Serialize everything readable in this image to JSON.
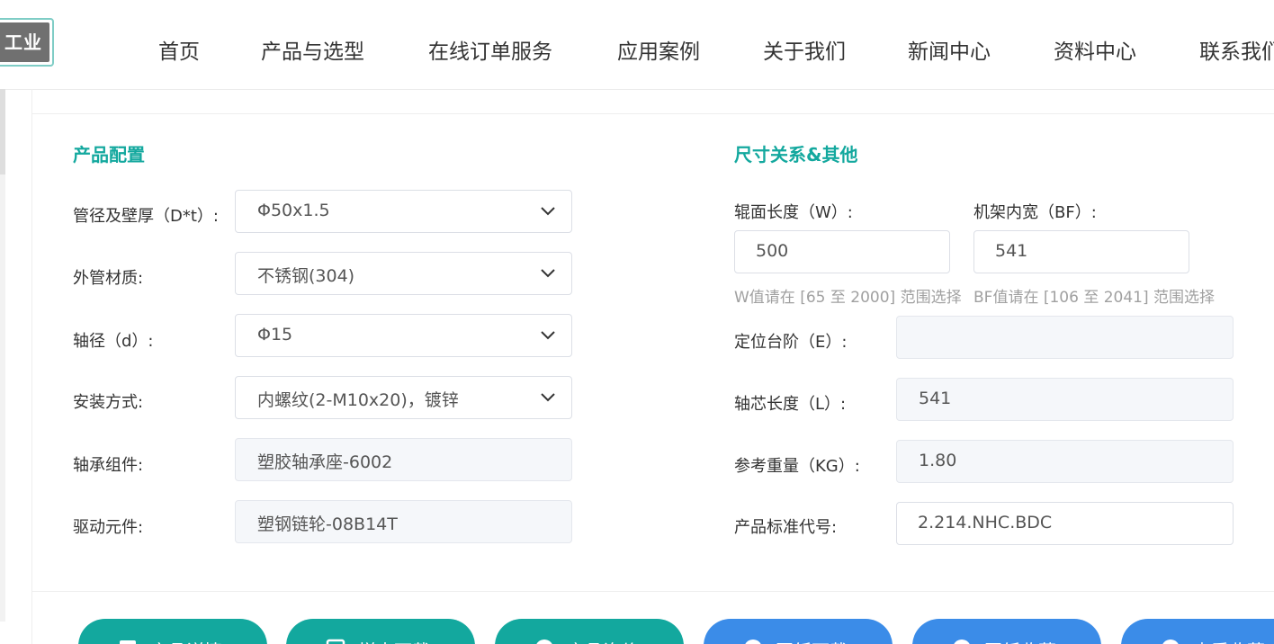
{
  "header": {
    "logo_text": "工业",
    "nav": [
      "首页",
      "产品与选型",
      "在线订单服务",
      "应用案例",
      "关于我们",
      "新闻中心",
      "资料中心",
      "联系我们"
    ]
  },
  "left_section": {
    "title": "产品配置",
    "fields": [
      {
        "label": "管径及壁厚（D*t）:",
        "value": "Φ50x1.5",
        "type": "select"
      },
      {
        "label": "外管材质:",
        "value": "不锈钢(304)",
        "type": "select"
      },
      {
        "label": "轴径（d）:",
        "value": "Φ15",
        "type": "select"
      },
      {
        "label": "安装方式:",
        "value": "内螺纹(2-M10x20)，镀锌",
        "type": "select"
      },
      {
        "label": "轴承组件:",
        "value": "塑胶轴承座-6002",
        "type": "readonly"
      },
      {
        "label": "驱动元件:",
        "value": "塑钢链轮-08B14T",
        "type": "readonly"
      }
    ]
  },
  "right_section": {
    "title": "尺寸关系&其他",
    "w_label": "辊面长度（W）:",
    "w_value": "500",
    "w_hint": "W值请在 [65 至 2000] 范围选择",
    "bf_label": "机架内宽（BF）:",
    "bf_value": "541",
    "bf_hint": "BF值请在 [106 至 2041] 范围选择",
    "fields": [
      {
        "label": "定位台阶（E）:",
        "value": "",
        "type": "readonly"
      },
      {
        "label": "轴芯长度（L）:",
        "value": "541",
        "type": "readonly"
      },
      {
        "label": "参考重量（KG）:",
        "value": "1.80",
        "type": "readonly"
      },
      {
        "label": "产品标准代号:",
        "value": "2.214.NHC.BDC",
        "type": "input"
      }
    ]
  },
  "buttons": [
    {
      "label": "产品详情",
      "icon": "document-icon",
      "color": "#13a89e"
    },
    {
      "label": "样本下载",
      "icon": "download-icon",
      "color": "#13a89e"
    },
    {
      "label": "产品询价",
      "icon": "price-icon",
      "color": "#13a89e"
    },
    {
      "label": "图纸下载",
      "icon": "drawing-icon",
      "color": "#3b8ce8"
    },
    {
      "label": "图纸收藏",
      "icon": "star-icon",
      "color": "#3b8ce8"
    },
    {
      "label": "查看收藏",
      "icon": "favorites-icon",
      "color": "#3b8ce8"
    }
  ],
  "colors": {
    "accent": "#13a89e",
    "blue": "#3b8ce8",
    "readonly_bg": "#f5f7fa"
  }
}
